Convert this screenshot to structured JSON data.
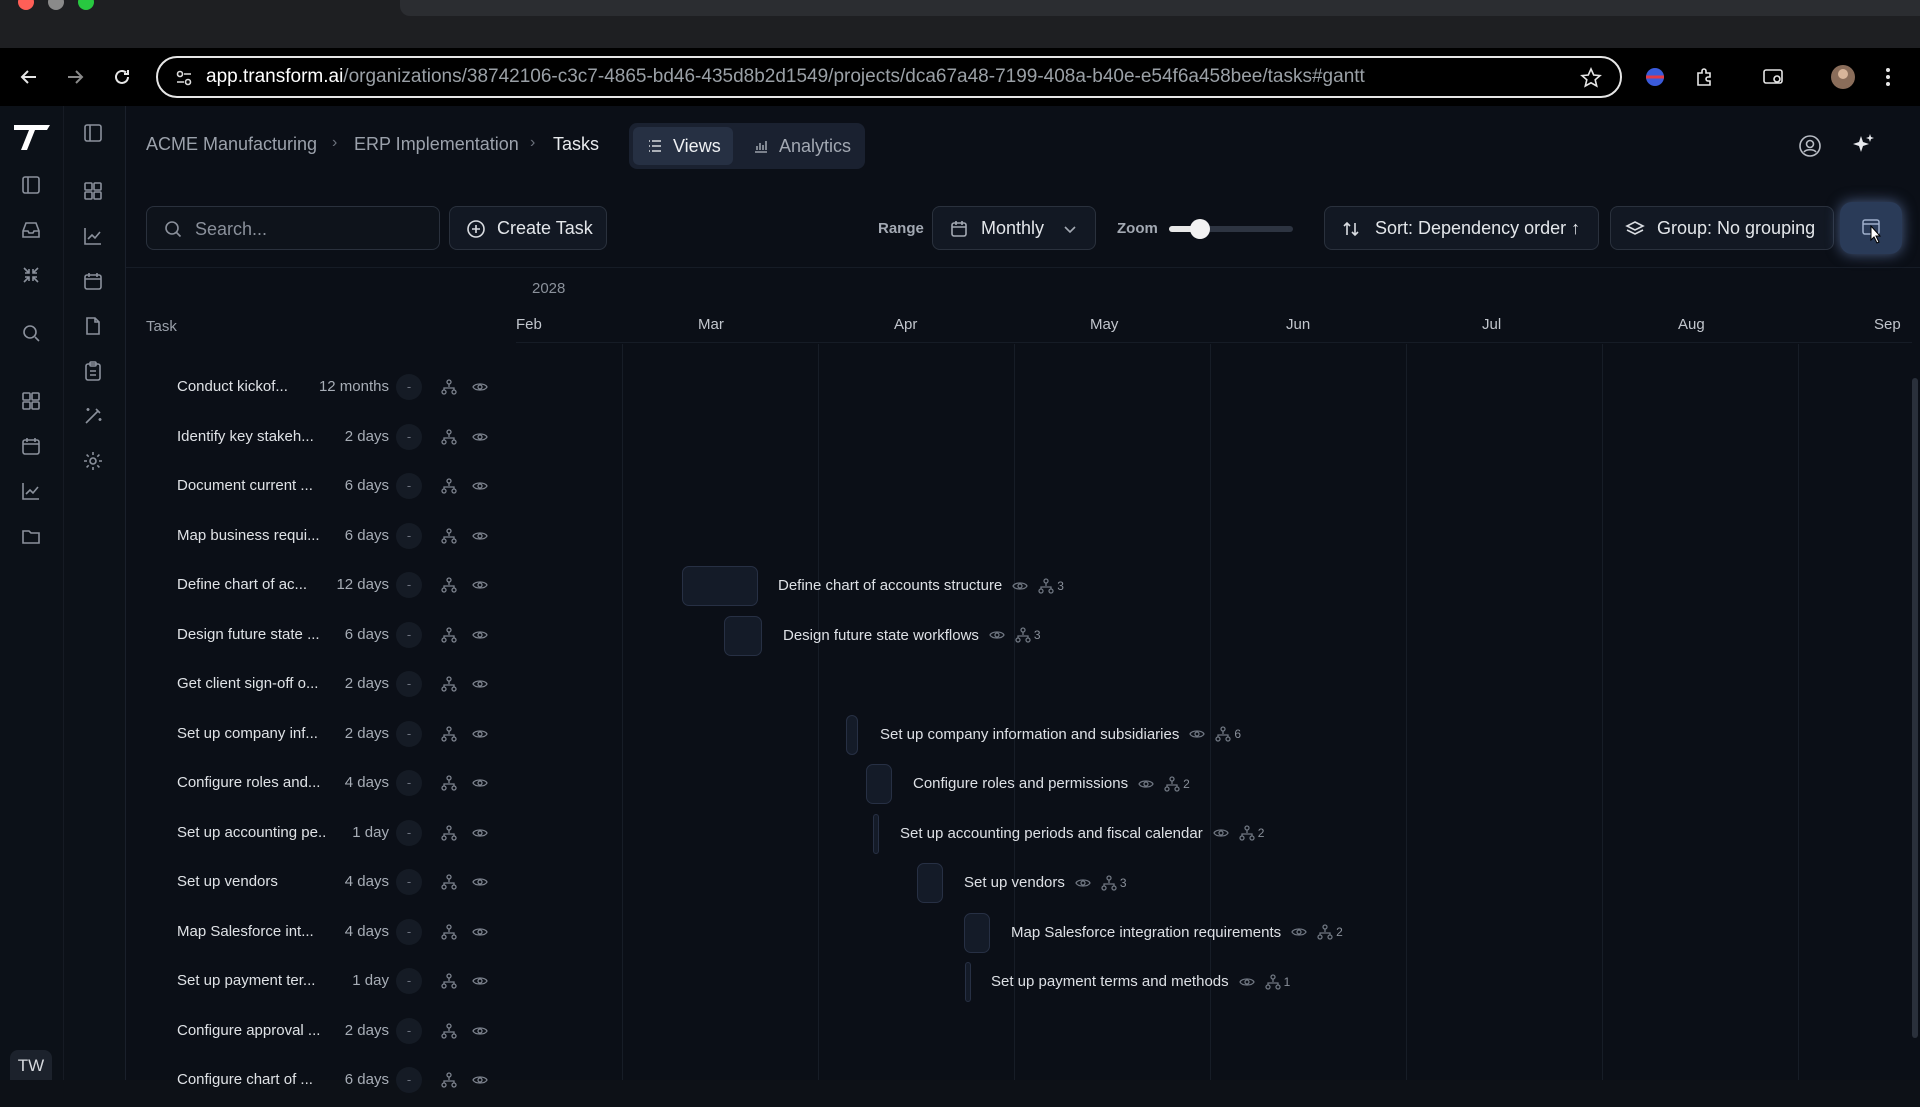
{
  "browser": {
    "url_host": "app.transform.ai",
    "url_path": "/organizations/38742106-c3c7-4865-bd46-435d8b2d1549/projects/dca67a48-7199-408a-b40e-e54f6a458bee/tasks#gantt"
  },
  "sidebar": {
    "user_initials": "TW"
  },
  "breadcrumb": [
    "ACME Manufacturing",
    "ERP Implementation",
    "Tasks"
  ],
  "view_tabs": [
    {
      "label": "Views",
      "icon": "list-icon",
      "active": true
    },
    {
      "label": "Analytics",
      "icon": "bar-chart-icon",
      "active": false
    }
  ],
  "toolbar": {
    "search_placeholder": "Search...",
    "create_task": "Create Task",
    "range_label": "Range",
    "range_value": "Monthly",
    "zoom_label": "Zoom",
    "zoom_level": 0.25,
    "sort": "Sort: Dependency order ↑",
    "group": "Group: No grouping"
  },
  "task_list": {
    "header": "Task",
    "rows": [
      {
        "name": "Conduct kickof...",
        "duration": "12 months",
        "dep": "-"
      },
      {
        "name": "Identify key stakeh...",
        "duration": "2 days",
        "dep": "-"
      },
      {
        "name": "Document current ...",
        "duration": "6 days",
        "dep": "-"
      },
      {
        "name": "Map business requi...",
        "duration": "6 days",
        "dep": "-"
      },
      {
        "name": "Define chart of ac...",
        "duration": "12 days",
        "dep": "-"
      },
      {
        "name": "Design future state ...",
        "duration": "6 days",
        "dep": "-"
      },
      {
        "name": "Get client sign-off o...",
        "duration": "2 days",
        "dep": "-"
      },
      {
        "name": "Set up company inf...",
        "duration": "2 days",
        "dep": "-"
      },
      {
        "name": "Configure roles and...",
        "duration": "4 days",
        "dep": "-"
      },
      {
        "name": "Set up accounting pe...",
        "duration": "1 day",
        "dep": "-"
      },
      {
        "name": "Set up vendors",
        "duration": "4 days",
        "dep": "-"
      },
      {
        "name": "Map Salesforce int...",
        "duration": "4 days",
        "dep": "-"
      },
      {
        "name": "Set up payment ter...",
        "duration": "1 day",
        "dep": "-"
      },
      {
        "name": "Configure approval ...",
        "duration": "2 days",
        "dep": "-"
      },
      {
        "name": "Configure chart of ...",
        "duration": "6 days",
        "dep": "-"
      }
    ]
  },
  "gantt": {
    "year": "2028",
    "months": [
      "Feb",
      "Mar",
      "Apr",
      "May",
      "Jun",
      "Jul",
      "Aug",
      "Sep"
    ],
    "bars": [
      {
        "row": 4,
        "label": "Define chart of accounts structure",
        "deps": "3"
      },
      {
        "row": 5,
        "label": "Design future state workflows",
        "deps": "3"
      },
      {
        "row": 7,
        "label": "Set up company information and subsidiaries",
        "deps": "6"
      },
      {
        "row": 8,
        "label": "Configure roles and permissions",
        "deps": "2"
      },
      {
        "row": 9,
        "label": "Set up accounting periods and fiscal calendar",
        "deps": "2"
      },
      {
        "row": 10,
        "label": "Set up vendors",
        "deps": "3"
      },
      {
        "row": 11,
        "label": "Map Salesforce integration requirements",
        "deps": "2"
      },
      {
        "row": 12,
        "label": "Set up payment terms and methods",
        "deps": "1"
      }
    ]
  },
  "colors": {
    "background": "#0b0f17",
    "accent_button": "#2a3b58"
  }
}
